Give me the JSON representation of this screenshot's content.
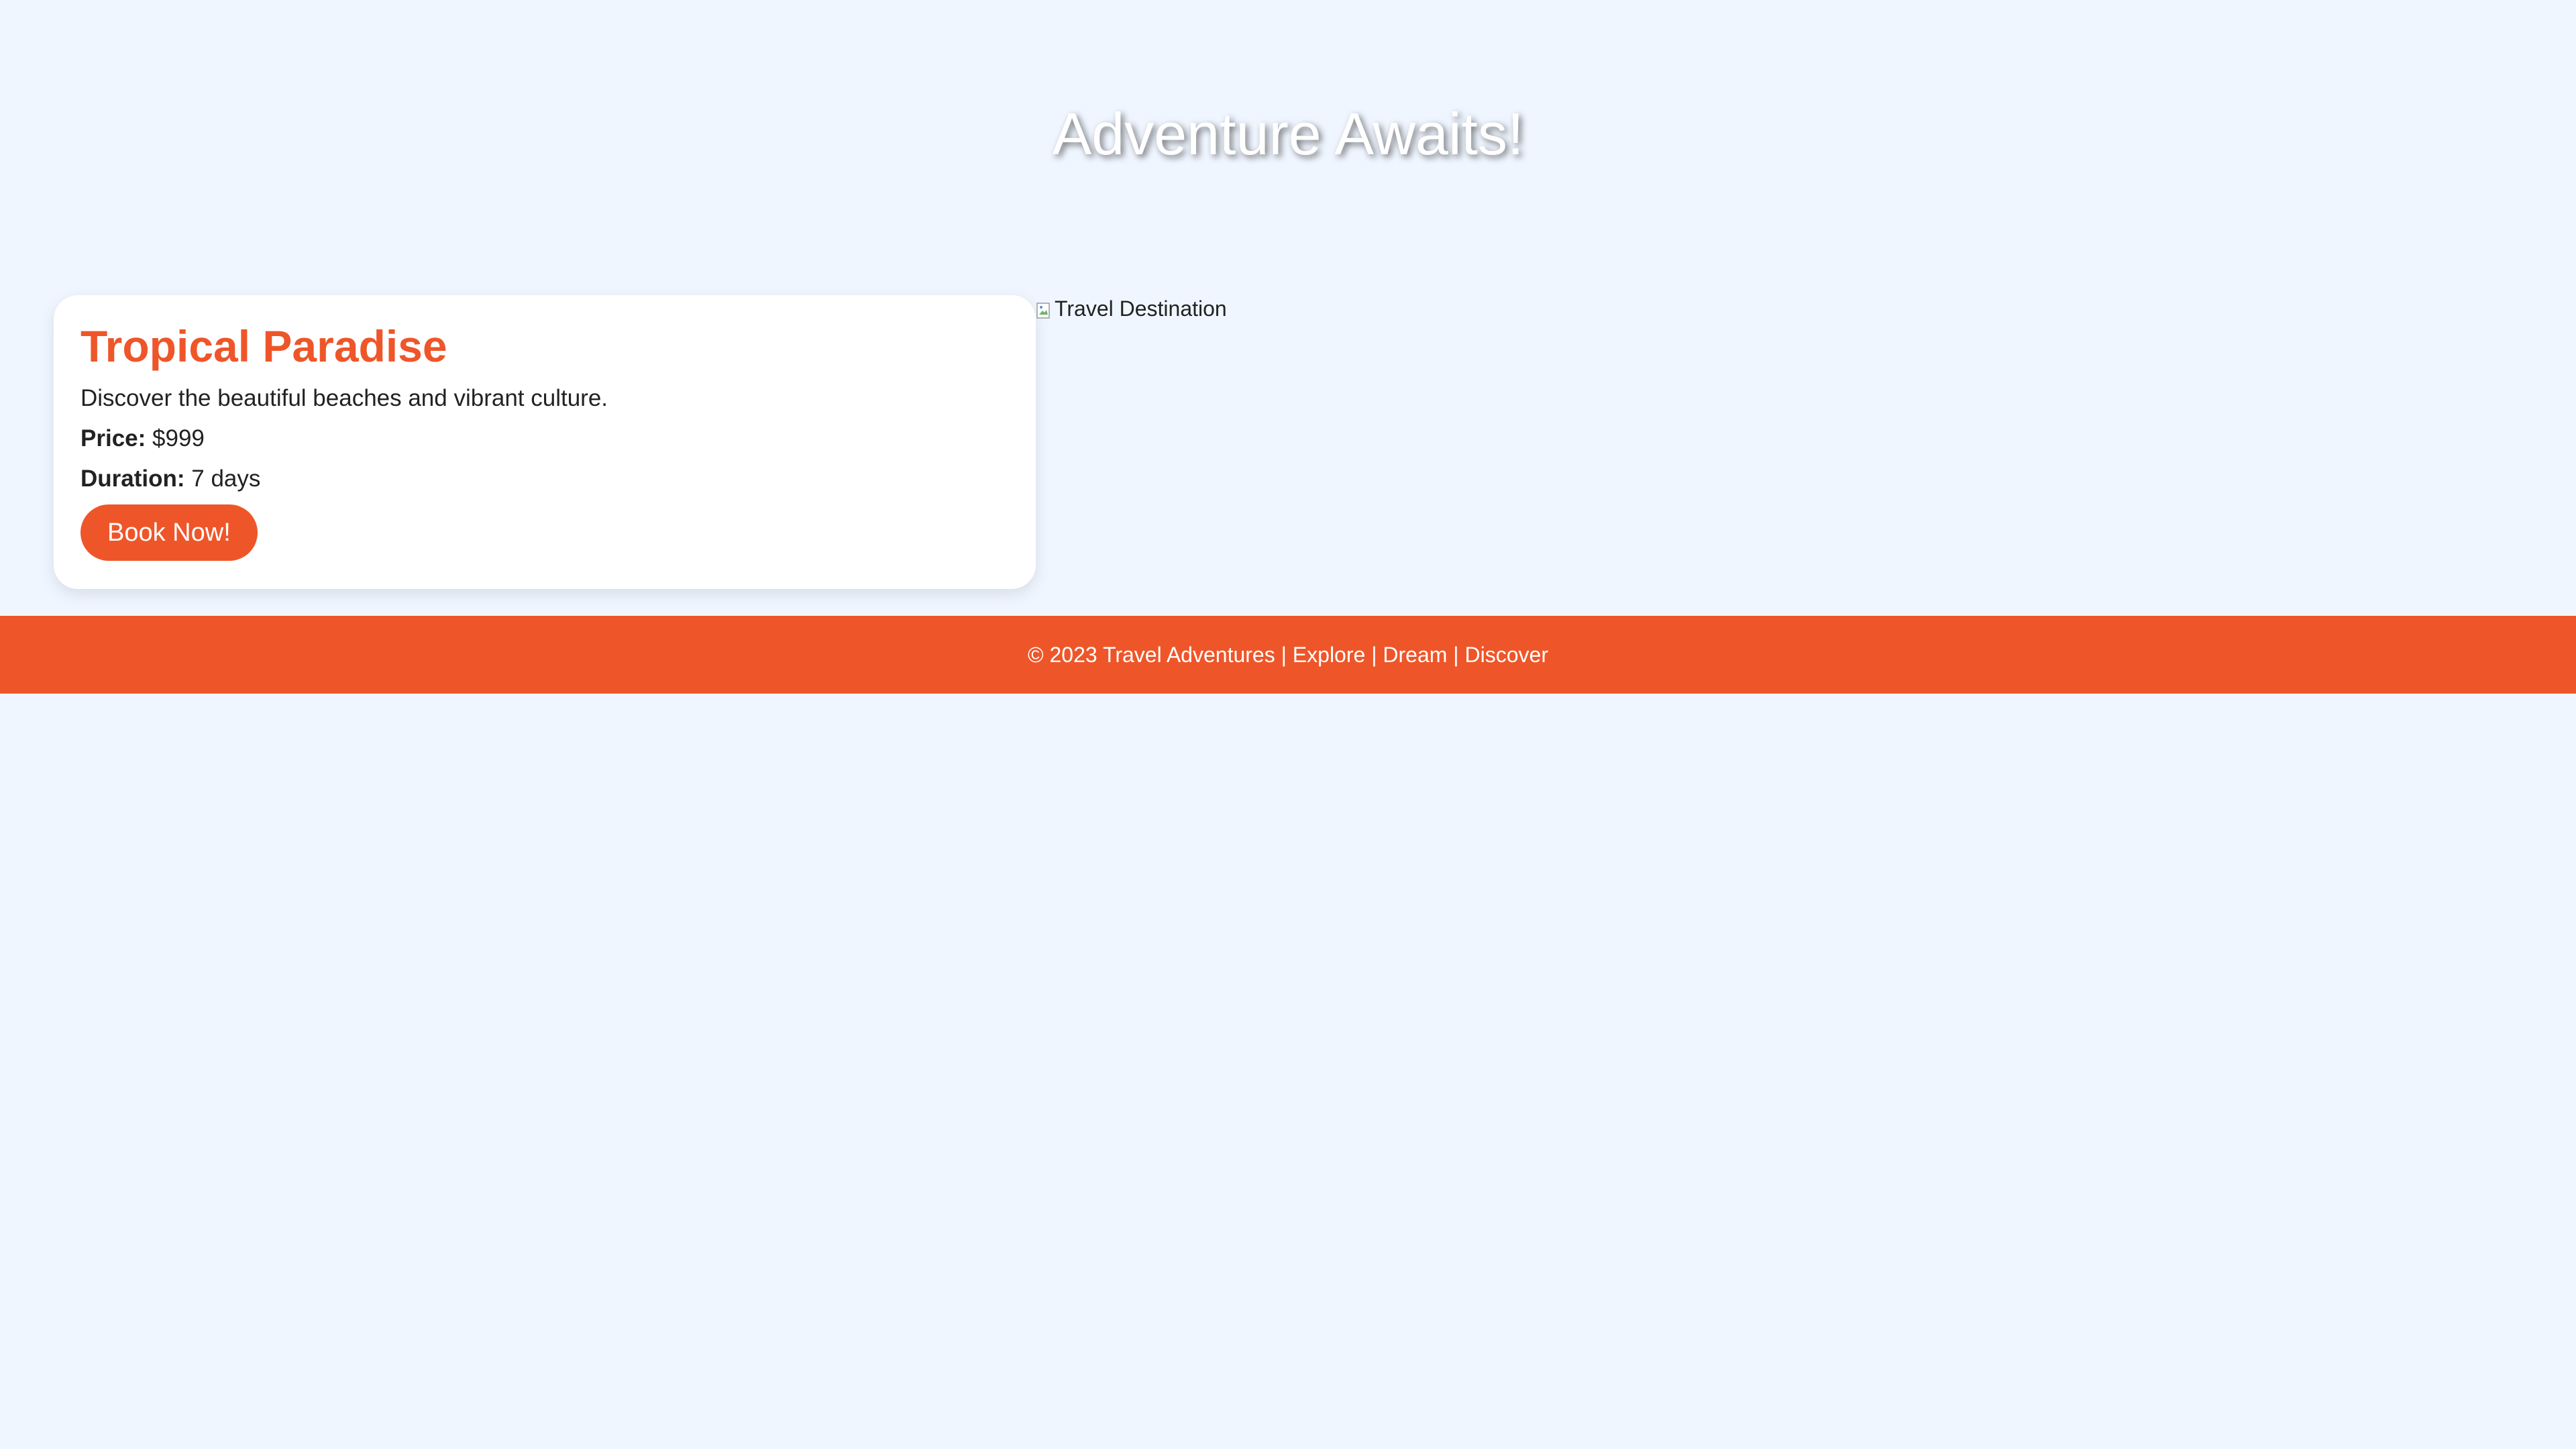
{
  "hero": {
    "title": "Adventure Awaits!"
  },
  "card": {
    "title": "Tropical Paradise",
    "description": "Discover the beautiful beaches and vibrant culture.",
    "price_label": "Price:",
    "price_value": "$999",
    "duration_label": "Duration:",
    "duration_value": "7 days",
    "button_label": "Book Now!"
  },
  "image": {
    "alt": "Travel Destination",
    "icon": "broken-image-icon"
  },
  "footer": {
    "text": "© 2023 Travel Adventures | Explore | Dream | Discover"
  },
  "colors": {
    "background": "#f0f6ff",
    "accent": "#ee5629",
    "card": "#ffffff",
    "text": "#222222"
  }
}
